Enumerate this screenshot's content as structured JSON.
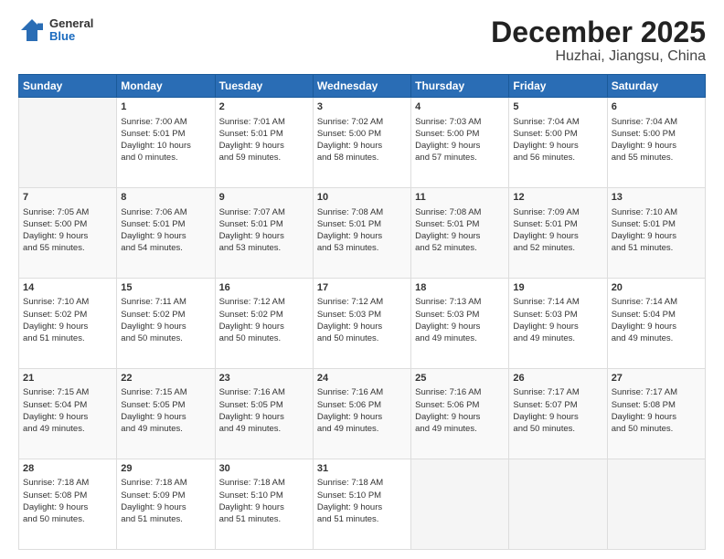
{
  "header": {
    "logo": {
      "general": "General",
      "blue": "Blue"
    },
    "title": "December 2025",
    "subtitle": "Huzhai, Jiangsu, China"
  },
  "calendar": {
    "days_header": [
      "Sunday",
      "Monday",
      "Tuesday",
      "Wednesday",
      "Thursday",
      "Friday",
      "Saturday"
    ],
    "weeks": [
      [
        {
          "day": "",
          "content": ""
        },
        {
          "day": "1",
          "content": "Sunrise: 7:00 AM\nSunset: 5:01 PM\nDaylight: 10 hours\nand 0 minutes."
        },
        {
          "day": "2",
          "content": "Sunrise: 7:01 AM\nSunset: 5:01 PM\nDaylight: 9 hours\nand 59 minutes."
        },
        {
          "day": "3",
          "content": "Sunrise: 7:02 AM\nSunset: 5:00 PM\nDaylight: 9 hours\nand 58 minutes."
        },
        {
          "day": "4",
          "content": "Sunrise: 7:03 AM\nSunset: 5:00 PM\nDaylight: 9 hours\nand 57 minutes."
        },
        {
          "day": "5",
          "content": "Sunrise: 7:04 AM\nSunset: 5:00 PM\nDaylight: 9 hours\nand 56 minutes."
        },
        {
          "day": "6",
          "content": "Sunrise: 7:04 AM\nSunset: 5:00 PM\nDaylight: 9 hours\nand 55 minutes."
        }
      ],
      [
        {
          "day": "7",
          "content": "Sunrise: 7:05 AM\nSunset: 5:00 PM\nDaylight: 9 hours\nand 55 minutes."
        },
        {
          "day": "8",
          "content": "Sunrise: 7:06 AM\nSunset: 5:01 PM\nDaylight: 9 hours\nand 54 minutes."
        },
        {
          "day": "9",
          "content": "Sunrise: 7:07 AM\nSunset: 5:01 PM\nDaylight: 9 hours\nand 53 minutes."
        },
        {
          "day": "10",
          "content": "Sunrise: 7:08 AM\nSunset: 5:01 PM\nDaylight: 9 hours\nand 53 minutes."
        },
        {
          "day": "11",
          "content": "Sunrise: 7:08 AM\nSunset: 5:01 PM\nDaylight: 9 hours\nand 52 minutes."
        },
        {
          "day": "12",
          "content": "Sunrise: 7:09 AM\nSunset: 5:01 PM\nDaylight: 9 hours\nand 52 minutes."
        },
        {
          "day": "13",
          "content": "Sunrise: 7:10 AM\nSunset: 5:01 PM\nDaylight: 9 hours\nand 51 minutes."
        }
      ],
      [
        {
          "day": "14",
          "content": "Sunrise: 7:10 AM\nSunset: 5:02 PM\nDaylight: 9 hours\nand 51 minutes."
        },
        {
          "day": "15",
          "content": "Sunrise: 7:11 AM\nSunset: 5:02 PM\nDaylight: 9 hours\nand 50 minutes."
        },
        {
          "day": "16",
          "content": "Sunrise: 7:12 AM\nSunset: 5:02 PM\nDaylight: 9 hours\nand 50 minutes."
        },
        {
          "day": "17",
          "content": "Sunrise: 7:12 AM\nSunset: 5:03 PM\nDaylight: 9 hours\nand 50 minutes."
        },
        {
          "day": "18",
          "content": "Sunrise: 7:13 AM\nSunset: 5:03 PM\nDaylight: 9 hours\nand 49 minutes."
        },
        {
          "day": "19",
          "content": "Sunrise: 7:14 AM\nSunset: 5:03 PM\nDaylight: 9 hours\nand 49 minutes."
        },
        {
          "day": "20",
          "content": "Sunrise: 7:14 AM\nSunset: 5:04 PM\nDaylight: 9 hours\nand 49 minutes."
        }
      ],
      [
        {
          "day": "21",
          "content": "Sunrise: 7:15 AM\nSunset: 5:04 PM\nDaylight: 9 hours\nand 49 minutes."
        },
        {
          "day": "22",
          "content": "Sunrise: 7:15 AM\nSunset: 5:05 PM\nDaylight: 9 hours\nand 49 minutes."
        },
        {
          "day": "23",
          "content": "Sunrise: 7:16 AM\nSunset: 5:05 PM\nDaylight: 9 hours\nand 49 minutes."
        },
        {
          "day": "24",
          "content": "Sunrise: 7:16 AM\nSunset: 5:06 PM\nDaylight: 9 hours\nand 49 minutes."
        },
        {
          "day": "25",
          "content": "Sunrise: 7:16 AM\nSunset: 5:06 PM\nDaylight: 9 hours\nand 49 minutes."
        },
        {
          "day": "26",
          "content": "Sunrise: 7:17 AM\nSunset: 5:07 PM\nDaylight: 9 hours\nand 50 minutes."
        },
        {
          "day": "27",
          "content": "Sunrise: 7:17 AM\nSunset: 5:08 PM\nDaylight: 9 hours\nand 50 minutes."
        }
      ],
      [
        {
          "day": "28",
          "content": "Sunrise: 7:18 AM\nSunset: 5:08 PM\nDaylight: 9 hours\nand 50 minutes."
        },
        {
          "day": "29",
          "content": "Sunrise: 7:18 AM\nSunset: 5:09 PM\nDaylight: 9 hours\nand 51 minutes."
        },
        {
          "day": "30",
          "content": "Sunrise: 7:18 AM\nSunset: 5:10 PM\nDaylight: 9 hours\nand 51 minutes."
        },
        {
          "day": "31",
          "content": "Sunrise: 7:18 AM\nSunset: 5:10 PM\nDaylight: 9 hours\nand 51 minutes."
        },
        {
          "day": "",
          "content": ""
        },
        {
          "day": "",
          "content": ""
        },
        {
          "day": "",
          "content": ""
        }
      ]
    ]
  }
}
